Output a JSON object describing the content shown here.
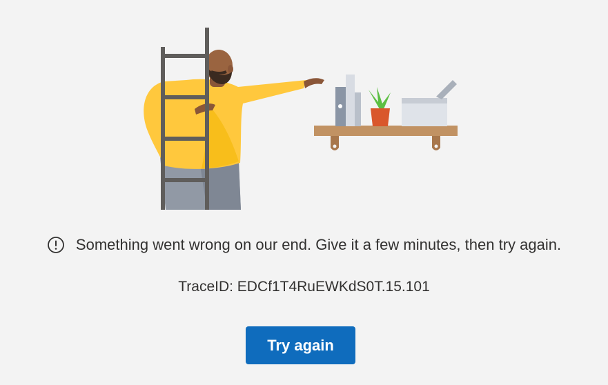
{
  "error": {
    "message": "Something went wrong on our end. Give it a few minutes, then try again.",
    "icon": "alert-circle-icon"
  },
  "trace": {
    "label": "TraceID: EDCf1T4RuEWKdS0T.15.101"
  },
  "actions": {
    "try_again_label": "Try again"
  },
  "colors": {
    "background": "#f3f3f3",
    "button": "#0f6cbd",
    "sweater": "#ffc83d",
    "ladder": "#5f5d5b",
    "shelf": "#c19263",
    "pot": "#d9572c",
    "plant": "#5cbf43"
  }
}
